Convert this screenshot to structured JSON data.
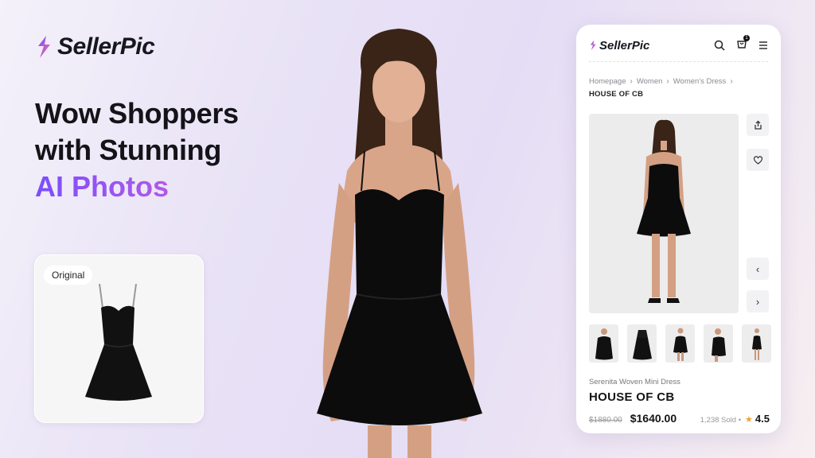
{
  "brand": {
    "name": "SellerPic"
  },
  "headline": {
    "line1": "Wow Shoppers",
    "line2": "with Stunning",
    "accent": "AI Photos"
  },
  "original": {
    "tag": "Original"
  },
  "phone": {
    "brand": "SellerPic",
    "cart_count": "1",
    "breadcrumb": [
      "Homepage",
      "Women",
      "Women's Dress"
    ],
    "breadcrumb_current": "HOUSE OF CB",
    "product_subtitle": "Serenita Woven Mini Dress",
    "product_title": "HOUSE OF CB",
    "old_price": "$1880.00",
    "new_price": "$1640.00",
    "sold": "1,238 Sold •",
    "rating": "4.5"
  },
  "colors": {
    "accent_start": "#7b4dff",
    "accent_end": "#f07a9a",
    "star": "#f2a12b"
  },
  "icons": [
    "logo-icon",
    "search-icon",
    "cart-icon",
    "menu-icon",
    "share-icon",
    "heart-icon",
    "chevron-left-icon",
    "chevron-right-icon",
    "chevron-right-small-icon",
    "star-icon"
  ]
}
